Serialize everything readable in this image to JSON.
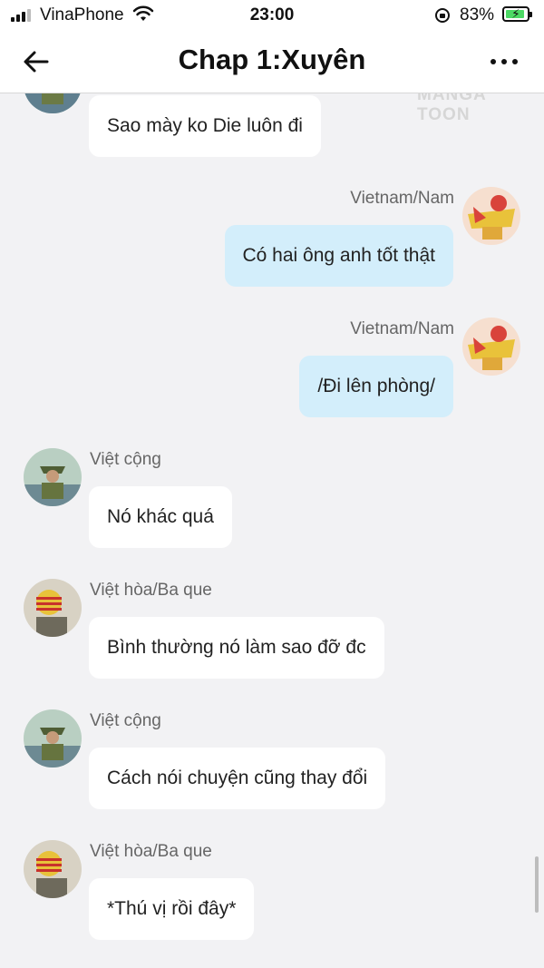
{
  "status_bar": {
    "carrier": "VinaPhone",
    "time": "23:00",
    "battery_percent": "83%",
    "signal_bars": 3,
    "charging": true
  },
  "header": {
    "title": "Chap 1:Xuyên",
    "back_icon": "arrow-left-icon",
    "more_icon": "more-horizontal-icon"
  },
  "watermark": "MANGA TOON",
  "messages": [
    {
      "side": "left",
      "name": "",
      "avatar": "green-avatar",
      "text": "Sao mày ko Die luôn đi"
    },
    {
      "side": "right",
      "name": "Vietnam/Nam",
      "avatar": "yellow-star-avatar",
      "text": "Có hai ông anh tốt thật"
    },
    {
      "side": "right",
      "name": "Vietnam/Nam",
      "avatar": "yellow-star-avatar",
      "text": "/Đi lên phòng/"
    },
    {
      "side": "left",
      "name": "Việt cộng",
      "avatar": "green-avatar",
      "text": "Nó khác quá"
    },
    {
      "side": "left",
      "name": "Việt hòa/Ba que",
      "avatar": "red-stripe-avatar",
      "text": "Bình thường nó làm sao đỡ đc"
    },
    {
      "side": "left",
      "name": "Việt cộng",
      "avatar": "green-avatar",
      "text": "Cách nói chuyện cũng thay đổi"
    },
    {
      "side": "left",
      "name": "Việt hòa/Ba que",
      "avatar": "red-stripe-avatar",
      "text": "*Thú vị rồi đây*"
    }
  ],
  "colors": {
    "background": "#f2f2f4",
    "left_bubble": "#ffffff",
    "right_bubble": "#d3eefb",
    "name_text": "#666666"
  }
}
